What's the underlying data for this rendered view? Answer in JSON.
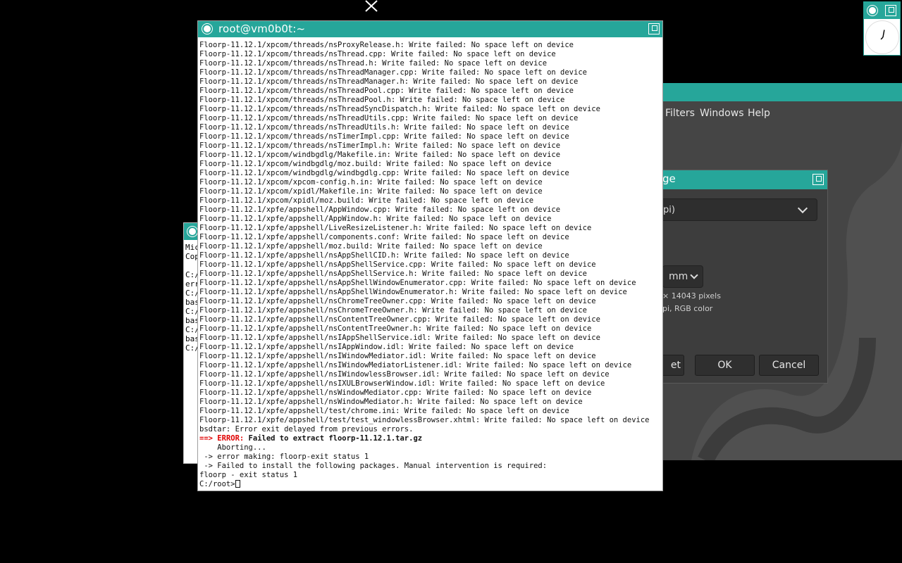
{
  "colors": {
    "titlebar": "#26a69a",
    "error": "#e00000",
    "gimp_bg": "#454545"
  },
  "gimp": {
    "menus": [
      "Filters",
      "Windows",
      "Help"
    ],
    "dialog": {
      "title_fragment": "ge",
      "select_value": "pi)",
      "unit": "mm",
      "info_line1": "× 14043 pixels",
      "info_line2": "pi, RGB color",
      "reset_fragment": "et",
      "ok_label": "OK",
      "cancel_label": "Cancel"
    }
  },
  "bg_terminal": {
    "lines": [
      "Mic",
      "Cop",
      "",
      "C:/",
      "err",
      "C:/",
      "bas",
      "C:/",
      "bas",
      "C:/",
      "bas",
      "C:/"
    ]
  },
  "terminal": {
    "title": "root@vm0b0t:~",
    "lines": [
      "Floorp-11.12.1/xpcom/threads/nsProxyRelease.h: Write failed: No space left on device",
      "Floorp-11.12.1/xpcom/threads/nsThread.cpp: Write failed: No space left on device",
      "Floorp-11.12.1/xpcom/threads/nsThread.h: Write failed: No space left on device",
      "Floorp-11.12.1/xpcom/threads/nsThreadManager.cpp: Write failed: No space left on device",
      "Floorp-11.12.1/xpcom/threads/nsThreadManager.h: Write failed: No space left on device",
      "Floorp-11.12.1/xpcom/threads/nsThreadPool.cpp: Write failed: No space left on device",
      "Floorp-11.12.1/xpcom/threads/nsThreadPool.h: Write failed: No space left on device",
      "Floorp-11.12.1/xpcom/threads/nsThreadSyncDispatch.h: Write failed: No space left on device",
      "Floorp-11.12.1/xpcom/threads/nsThreadUtils.cpp: Write failed: No space left on device",
      "Floorp-11.12.1/xpcom/threads/nsThreadUtils.h: Write failed: No space left on device",
      "Floorp-11.12.1/xpcom/threads/nsTimerImpl.cpp: Write failed: No space left on device",
      "Floorp-11.12.1/xpcom/threads/nsTimerImpl.h: Write failed: No space left on device",
      "Floorp-11.12.1/xpcom/windbgdlg/Makefile.in: Write failed: No space left on device",
      "Floorp-11.12.1/xpcom/windbgdlg/moz.build: Write failed: No space left on device",
      "Floorp-11.12.1/xpcom/windbgdlg/windbgdlg.cpp: Write failed: No space left on device",
      "Floorp-11.12.1/xpcom/xpcom-config.h.in: Write failed: No space left on device",
      "Floorp-11.12.1/xpcom/xpidl/Makefile.in: Write failed: No space left on device",
      "Floorp-11.12.1/xpcom/xpidl/moz.build: Write failed: No space left on device",
      "Floorp-11.12.1/xpfe/appshell/AppWindow.cpp: Write failed: No space left on device",
      "Floorp-11.12.1/xpfe/appshell/AppWindow.h: Write failed: No space left on device",
      "Floorp-11.12.1/xpfe/appshell/LiveResizeListener.h: Write failed: No space left on device",
      "Floorp-11.12.1/xpfe/appshell/components.conf: Write failed: No space left on device",
      "Floorp-11.12.1/xpfe/appshell/moz.build: Write failed: No space left on device",
      "Floorp-11.12.1/xpfe/appshell/nsAppShellCID.h: Write failed: No space left on device",
      "Floorp-11.12.1/xpfe/appshell/nsAppShellService.cpp: Write failed: No space left on device",
      "Floorp-11.12.1/xpfe/appshell/nsAppShellService.h: Write failed: No space left on device",
      "Floorp-11.12.1/xpfe/appshell/nsAppShellWindowEnumerator.cpp: Write failed: No space left on device",
      "Floorp-11.12.1/xpfe/appshell/nsAppShellWindowEnumerator.h: Write failed: No space left on device",
      "Floorp-11.12.1/xpfe/appshell/nsChromeTreeOwner.cpp: Write failed: No space left on device",
      "Floorp-11.12.1/xpfe/appshell/nsChromeTreeOwner.h: Write failed: No space left on device",
      "Floorp-11.12.1/xpfe/appshell/nsContentTreeOwner.cpp: Write failed: No space left on device",
      "Floorp-11.12.1/xpfe/appshell/nsContentTreeOwner.h: Write failed: No space left on device",
      "Floorp-11.12.1/xpfe/appshell/nsIAppShellService.idl: Write failed: No space left on device",
      "Floorp-11.12.1/xpfe/appshell/nsIAppWindow.idl: Write failed: No space left on device",
      "Floorp-11.12.1/xpfe/appshell/nsIWindowMediator.idl: Write failed: No space left on device",
      "Floorp-11.12.1/xpfe/appshell/nsIWindowMediatorListener.idl: Write failed: No space left on device",
      "Floorp-11.12.1/xpfe/appshell/nsIWindowlessBrowser.idl: Write failed: No space left on device",
      "Floorp-11.12.1/xpfe/appshell/nsIXULBrowserWindow.idl: Write failed: No space left on device",
      "Floorp-11.12.1/xpfe/appshell/nsWindowMediator.cpp: Write failed: No space left on device",
      "Floorp-11.12.1/xpfe/appshell/nsWindowMediator.h: Write failed: No space left on device",
      "Floorp-11.12.1/xpfe/appshell/test/chrome.ini: Write failed: No space left on device",
      "Floorp-11.12.1/xpfe/appshell/test/test_windowlessBrowser.xhtml: Write failed: No space left on device",
      "bsdtar: Error exit delayed from previous errors."
    ],
    "error_arrow": "==>",
    "error_label": "ERROR:",
    "error_message": " Failed to extract floorp-11.12.1.tar.gz",
    "aborting": "    Aborting...",
    "tail_lines": [
      " -> error making: floorp-exit status 1",
      " -> Failed to install the following packages. Manual intervention is required:",
      "floorp - exit status 1"
    ],
    "prompt": "C:/root>"
  }
}
